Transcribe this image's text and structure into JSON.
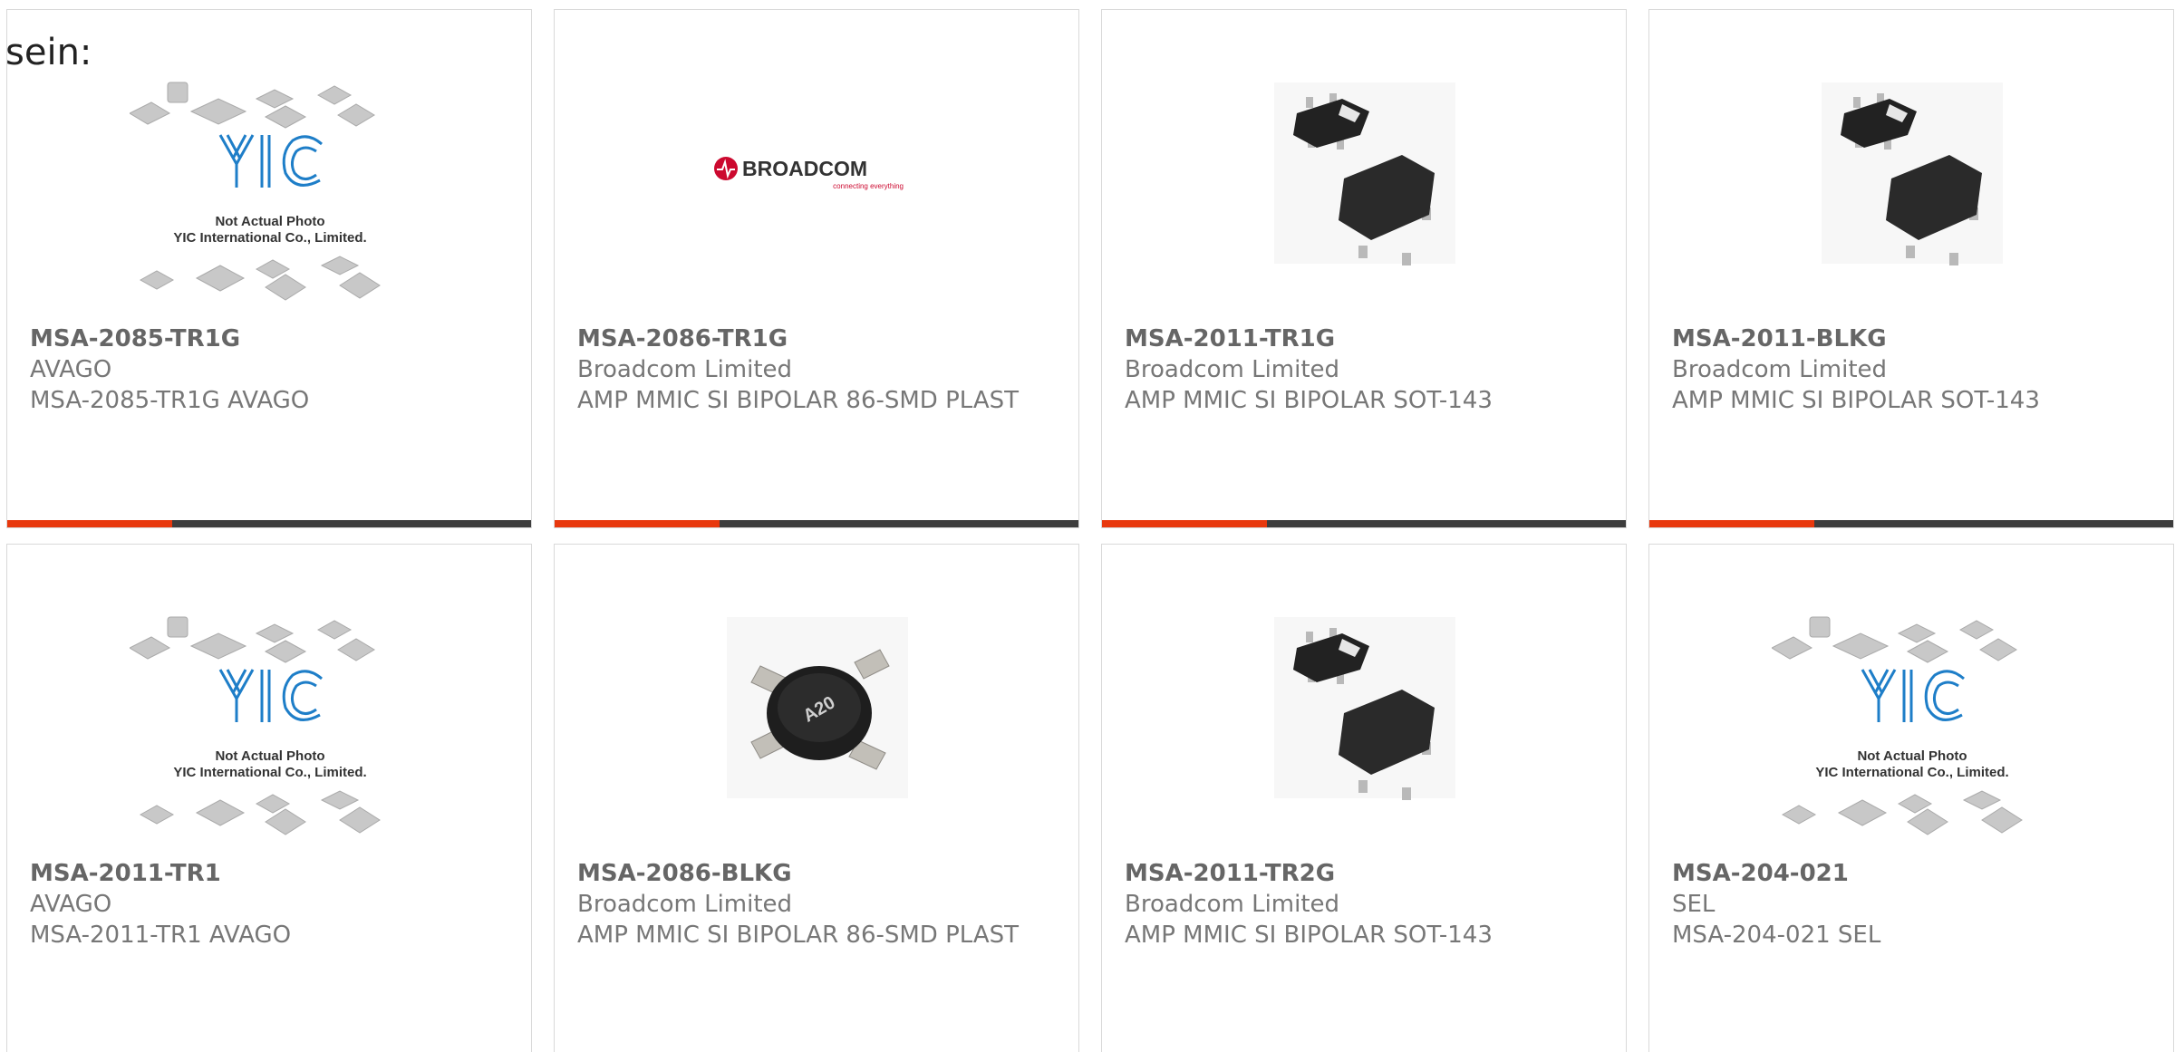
{
  "intro_text": "sein:",
  "placeholder_caption": [
    "Not Actual Photo",
    "YIC International Co., Limited."
  ],
  "placeholder_logo_text": "YIC",
  "broadcom_logo": {
    "name": "BROADCOM",
    "tagline": "connecting everything"
  },
  "colors": {
    "accent": "#e8380d",
    "bar": "#3d3d3d",
    "yic_blue": "#1e7ec8",
    "broadcom_red": "#cc092f"
  },
  "products": [
    {
      "part": "MSA-2085-TR1G",
      "maker": "AVAGO",
      "desc": "MSA-2085-TR1G AVAGO",
      "image": "placeholder-photo"
    },
    {
      "part": "MSA-2086-TR1G",
      "maker": "Broadcom Limited",
      "desc": "AMP MMIC SI BIPOLAR 86-SMD PLAST",
      "image": "broadcom-logo"
    },
    {
      "part": "MSA-2011-TR1G",
      "maker": "Broadcom Limited",
      "desc": "AMP MMIC SI BIPOLAR SOT-143",
      "image": "sot143-package"
    },
    {
      "part": "MSA-2011-BLKG",
      "maker": "Broadcom Limited",
      "desc": "AMP MMIC SI BIPOLAR SOT-143",
      "image": "sot143-package"
    },
    {
      "part": "MSA-2011-TR1",
      "maker": "AVAGO",
      "desc": "MSA-2011-TR1 AVAGO",
      "image": "placeholder-photo"
    },
    {
      "part": "MSA-2086-BLKG",
      "maker": "Broadcom Limited",
      "desc": "AMP MMIC SI BIPOLAR 86-SMD PLAST",
      "image": "smd86-package",
      "chip_marking": "A20"
    },
    {
      "part": "MSA-2011-TR2G",
      "maker": "Broadcom Limited",
      "desc": "AMP MMIC SI BIPOLAR SOT-143",
      "image": "sot143-package"
    },
    {
      "part": "MSA-204-021",
      "maker": "SEL",
      "desc": "MSA-204-021 SEL",
      "image": "placeholder-photo"
    }
  ]
}
